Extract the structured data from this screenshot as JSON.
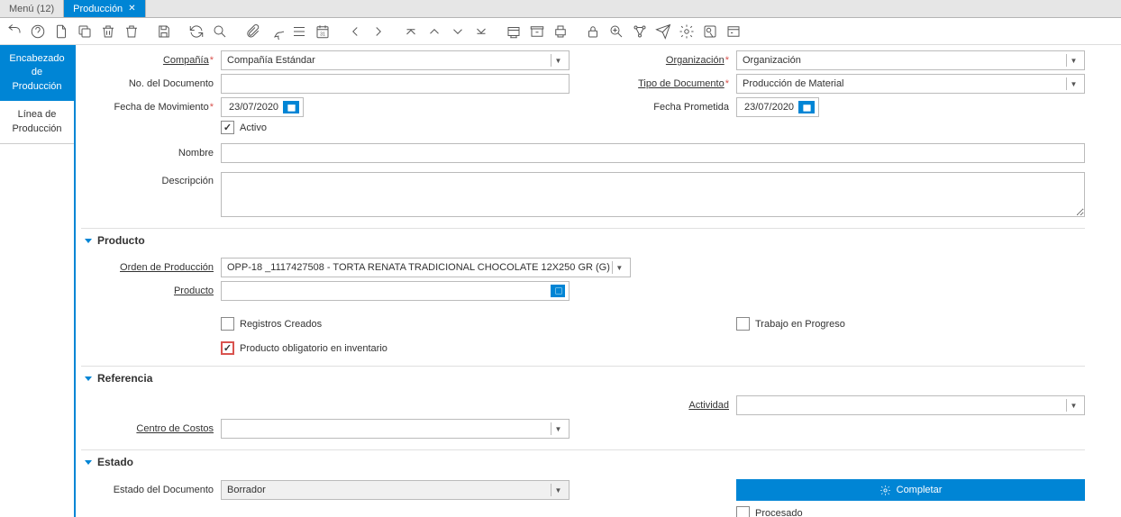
{
  "tabs": {
    "menu": "Menú (12)",
    "produccion": "Producción"
  },
  "side_tabs": {
    "header": "Encabezado de Producción",
    "line": "Línea de Producción"
  },
  "fields": {
    "compania": {
      "label": "Compañía",
      "value": "Compañía Estándar"
    },
    "organizacion": {
      "label": "Organización",
      "value": "Organización"
    },
    "no_documento": {
      "label": "No. del Documento",
      "value": ""
    },
    "tipo_documento": {
      "label": "Tipo de Documento",
      "value": "Producción de Material"
    },
    "fecha_movimiento": {
      "label": "Fecha de Movimiento",
      "value": "23/07/2020"
    },
    "fecha_prometida": {
      "label": "Fecha Prometida",
      "value": "23/07/2020"
    },
    "activo": {
      "label": "Activo",
      "checked": true
    },
    "nombre": {
      "label": "Nombre",
      "value": ""
    },
    "descripcion": {
      "label": "Descripción",
      "value": ""
    },
    "orden_produccion": {
      "label": "Orden de Producción",
      "value": "OPP-18 _1117427508  - TORTA RENATA TRADICIONAL CHOCOLATE 12X250 GR (G)"
    },
    "producto": {
      "label": "Producto",
      "value": ""
    },
    "registros_creados": {
      "label": "Registros Creados",
      "checked": false
    },
    "trabajo_progreso": {
      "label": "Trabajo en Progreso",
      "checked": false
    },
    "producto_obligatorio": {
      "label": "Producto obligatorio en inventario",
      "checked": true
    },
    "actividad": {
      "label": "Actividad",
      "value": ""
    },
    "centro_costos": {
      "label": "Centro de Costos",
      "value": ""
    },
    "estado_documento": {
      "label": "Estado del Documento",
      "value": "Borrador"
    },
    "completar": {
      "label": "Completar"
    },
    "procesado": {
      "label": "Procesado",
      "checked": false
    }
  },
  "sections": {
    "producto": "Producto",
    "referencia": "Referencia",
    "estado": "Estado"
  }
}
